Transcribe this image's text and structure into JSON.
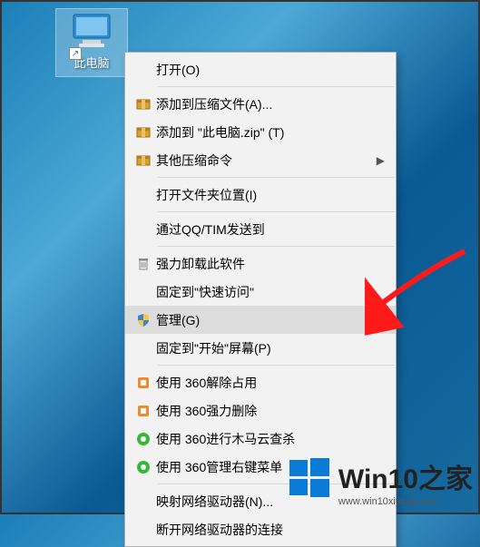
{
  "desktop": {
    "icon_label": "此电脑",
    "shortcut_glyph": "↗"
  },
  "context_menu": {
    "items": [
      {
        "label": "打开(O)",
        "icon": null,
        "submenu": false
      },
      {
        "sep": true
      },
      {
        "label": "添加到压缩文件(A)...",
        "icon": "archive",
        "submenu": false
      },
      {
        "label": "添加到 \"此电脑.zip\" (T)",
        "icon": "archive",
        "submenu": false
      },
      {
        "label": "其他压缩命令",
        "icon": "archive",
        "submenu": true
      },
      {
        "sep": true
      },
      {
        "label": "打开文件夹位置(I)",
        "icon": null,
        "submenu": false
      },
      {
        "sep": true
      },
      {
        "label": "通过QQ/TIM发送到",
        "icon": null,
        "submenu": false
      },
      {
        "sep": true
      },
      {
        "label": "强力卸载此软件",
        "icon": "trash",
        "submenu": false
      },
      {
        "label": "固定到\"快速访问\"",
        "icon": null,
        "submenu": false
      },
      {
        "label": "管理(G)",
        "icon": "shield",
        "submenu": false,
        "highlight": true
      },
      {
        "label": "固定到\"开始\"屏幕(P)",
        "icon": null,
        "submenu": false
      },
      {
        "sep": true
      },
      {
        "label": "使用 360解除占用",
        "icon": "360orange",
        "submenu": false
      },
      {
        "label": "使用 360强力删除",
        "icon": "360orange",
        "submenu": false
      },
      {
        "label": "使用 360进行木马云查杀",
        "icon": "360green",
        "submenu": false
      },
      {
        "label": "使用 360管理右键菜单",
        "icon": "360green",
        "submenu": false
      },
      {
        "sep": true
      },
      {
        "label": "映射网络驱动器(N)...",
        "icon": null,
        "submenu": false
      },
      {
        "label": "断开网络驱动器的连接",
        "icon": null,
        "submenu": false
      }
    ]
  },
  "watermark": {
    "text": "Win10之家",
    "url": "www.win10xitong.com"
  },
  "colors": {
    "shield_blue": "#3b82d6",
    "shield_yellow": "#f8c93a",
    "360_orange": "#f08a2c",
    "360_green": "#35b836",
    "arrow_red": "#ff1a1a"
  }
}
